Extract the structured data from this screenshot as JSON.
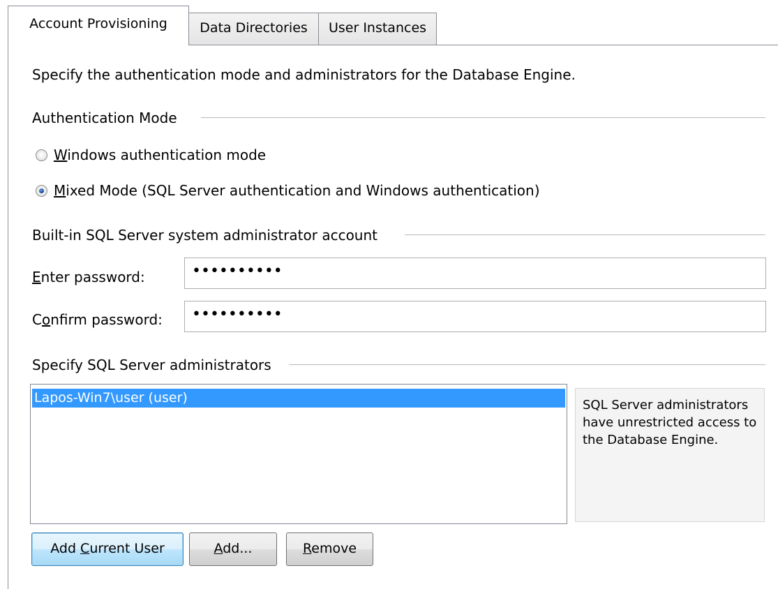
{
  "tabs": [
    {
      "label": "Account Provisioning",
      "active": true
    },
    {
      "label": "Data Directories",
      "active": false
    },
    {
      "label": "User Instances",
      "active": false
    }
  ],
  "description": "Specify the authentication mode and administrators for the Database Engine.",
  "auth_mode": {
    "heading": "Authentication Mode",
    "options": [
      {
        "label": "Windows authentication mode",
        "selected": false
      },
      {
        "label": "Mixed Mode (SQL Server authentication and Windows authentication)",
        "selected": true
      }
    ]
  },
  "sa_account": {
    "heading": "Built-in SQL Server system administrator account",
    "enter_password_label": "Enter password:",
    "enter_password_value": "••••••••••",
    "confirm_password_label": "Confirm password:",
    "confirm_password_value": "••••••••••"
  },
  "administrators": {
    "heading": "Specify SQL Server administrators",
    "list_items": [
      "Lapos-Win7\\user (user)"
    ],
    "info_text": "SQL Server administrators have unrestricted access to the Database Engine."
  },
  "buttons": {
    "add_current_user": "Add Current User",
    "add": "Add...",
    "remove": "Remove"
  },
  "colors": {
    "selection": "#3399ff",
    "radio_dot": "#1b4f9a"
  }
}
